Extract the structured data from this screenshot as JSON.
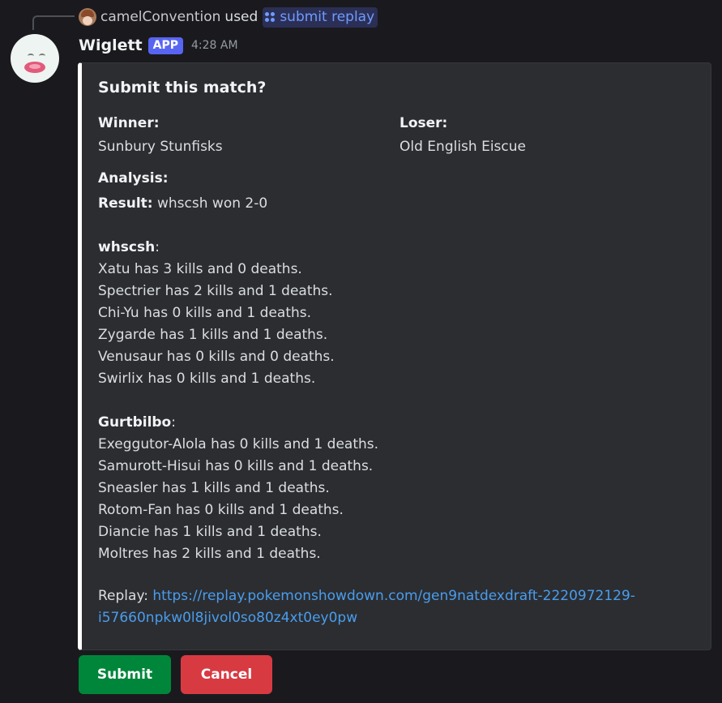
{
  "reply": {
    "username": "camelConvention",
    "action": "used",
    "command": "submit replay"
  },
  "message": {
    "bot_name": "Wiglett",
    "badge": "APP",
    "timestamp": "4:28 AM"
  },
  "embed": {
    "title": "Submit this match?",
    "winner_label": "Winner:",
    "winner_value": "Sunbury Stunfisks",
    "loser_label": "Loser:",
    "loser_value": "Old English Eiscue",
    "analysis_label": "Analysis:",
    "result_label": "Result:",
    "result_value": " whscsh won 2-0",
    "team1": {
      "name": "whscsh",
      "lines": [
        "Xatu has 3 kills and 0 deaths.",
        "Spectrier has 2 kills and 1 deaths.",
        "Chi-Yu has 0 kills and 1 deaths.",
        "Zygarde has 1 kills and 1 deaths.",
        "Venusaur has 0 kills and 0 deaths.",
        "Swirlix has 0 kills and 1 deaths."
      ]
    },
    "team2": {
      "name": "Gurtbilbo",
      "lines": [
        "Exeggutor-Alola has 0 kills and 1 deaths.",
        "Samurott-Hisui has 0 kills and 1 deaths.",
        "Sneasler has 1 kills and 1 deaths.",
        "Rotom-Fan has 0 kills and 1 deaths.",
        "Diancie has 1 kills and 1 deaths.",
        "Moltres has 2 kills and 1 deaths."
      ]
    },
    "replay_label": "Replay: ",
    "replay_url_line1": "https://replay.pokemonshowdown.com/gen9natdexdraft-2220972129-",
    "replay_url_line2": "i57660npkw0l8jivol0so80z4xt0ey0pw"
  },
  "buttons": {
    "submit": "Submit",
    "cancel": "Cancel"
  },
  "colors": {
    "background": "#1a1a1e",
    "embed_bg": "#2b2d31",
    "embed_accent": "#ffffff",
    "app_badge": "#5865f2",
    "link": "#4a9ded",
    "submit_button": "#00863a",
    "cancel_button": "#d83a42"
  },
  "icons": {
    "reply_avatar": "user-avatar-icon",
    "command": "slash-command-icon",
    "bot_avatar": "wiglett-avatar-icon"
  }
}
